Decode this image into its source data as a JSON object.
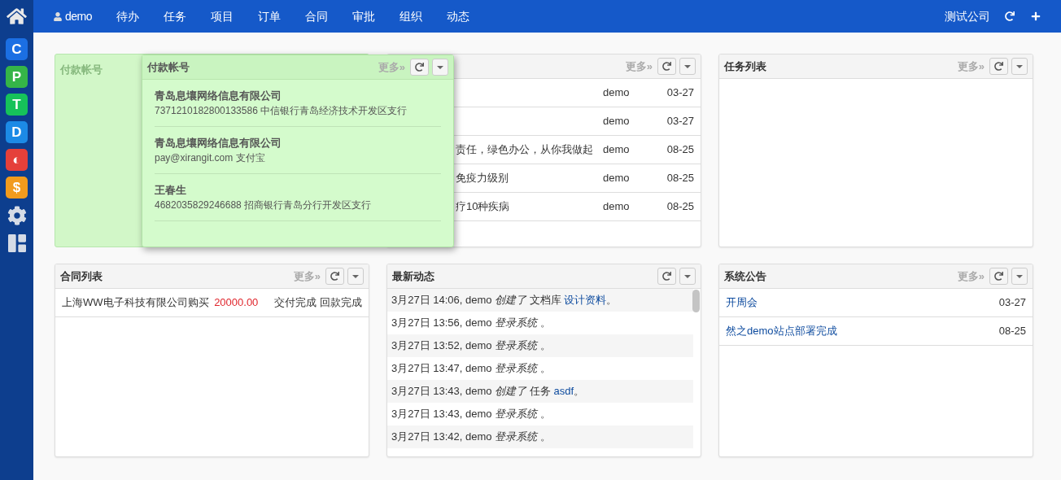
{
  "sidebar": {
    "apps": [
      {
        "label": "C",
        "color": "#1b6fe3"
      },
      {
        "label": "P",
        "color": "#35b548"
      },
      {
        "label": "T",
        "color": "#16c25a"
      },
      {
        "label": "D",
        "color": "#1c8ae6"
      },
      {
        "label": "◐",
        "color": "#e5403a"
      },
      {
        "label": "$",
        "color": "#f29b1d"
      }
    ]
  },
  "topbar": {
    "user": "demo",
    "nav": [
      "待办",
      "任务",
      "项目",
      "订单",
      "合同",
      "审批",
      "组织",
      "动态"
    ],
    "company": "测试公司"
  },
  "payment_panel": {
    "placeholder_title": "付款帐号",
    "title": "付款帐号",
    "more": "更多»",
    "accounts": [
      {
        "name": "青岛息壤网络信息有限公司",
        "detail": "7371210182800133586 中信银行青岛经济技术开发区支行"
      },
      {
        "name": "青岛息壤网络信息有限公司",
        "detail": "pay@xirangit.com 支付宝"
      },
      {
        "name": "王春生",
        "detail": "4682035829246688 招商银行青岛分行开发区支行"
      }
    ]
  },
  "news_panel": {
    "more": "更多»",
    "rows": [
      {
        "user": "demo",
        "date": "03-27"
      },
      {
        "user": "demo",
        "date": "03-27"
      },
      {
        "title": "责任，绿色办公，从你我做起",
        "user": "demo",
        "date": "08-25"
      },
      {
        "title": "免疫力级别",
        "user": "demo",
        "date": "08-25"
      },
      {
        "title": "疗10种疾病",
        "user": "demo",
        "date": "08-25"
      }
    ]
  },
  "task_panel": {
    "title": "任务列表",
    "more": "更多»"
  },
  "contract_panel": {
    "title": "合同列表",
    "more": "更多»",
    "rows": [
      {
        "name": "上海WW电子科技有限公司购买",
        "amount": "20000.00",
        "delivery": "交付完成",
        "payment": "回款完成"
      }
    ]
  },
  "activity_panel": {
    "title": "最新动态",
    "entries": [
      {
        "text": "3月27日 14:06, demo *创建了* 文档库 ",
        "link": "设计资料",
        "tail": "。"
      },
      {
        "text": "3月27日 13:56, demo *登录系统* 。"
      },
      {
        "text": "3月27日 13:52, demo *登录系统* 。"
      },
      {
        "text": "3月27日 13:47, demo *登录系统* 。"
      },
      {
        "text": "3月27日 13:43, demo *创建了* 任务 ",
        "link": "asdf",
        "tail": "。"
      },
      {
        "text": "3月27日 13:43, demo *登录系统* 。"
      },
      {
        "text": "3月27日 13:42, demo *登录系统* 。"
      }
    ]
  },
  "notice_panel": {
    "title": "系统公告",
    "more": "更多»",
    "rows": [
      {
        "title": "开周会",
        "date": "03-27"
      },
      {
        "title": "然之demo站点部署完成",
        "date": "08-25"
      }
    ]
  }
}
